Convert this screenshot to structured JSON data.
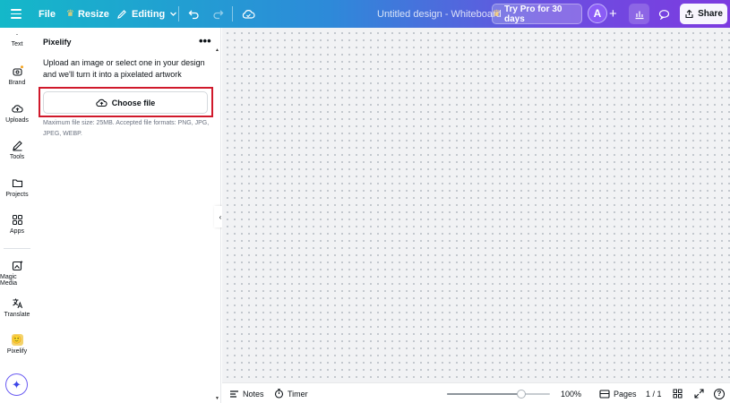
{
  "topbar": {
    "file_label": "File",
    "resize_label": "Resize",
    "editing_label": "Editing",
    "design_title": "Untitled design - Whiteboard",
    "pro_label": "Try Pro for 30 days",
    "avatar_initial": "A",
    "share_label": "Share",
    "gradient_colors": [
      "#14b8c9",
      "#2d8ad9",
      "#6b4fe0",
      "#7d3ae0"
    ]
  },
  "rail": {
    "items": [
      {
        "label": "Text",
        "icon": "text-icon"
      },
      {
        "label": "Brand",
        "icon": "brand-icon"
      },
      {
        "label": "Uploads",
        "icon": "cloud-upload-icon"
      },
      {
        "label": "Tools",
        "icon": "pen-icon"
      },
      {
        "label": "Projects",
        "icon": "folder-icon"
      },
      {
        "label": "Apps",
        "icon": "apps-grid-icon"
      },
      {
        "label": "Magic Media",
        "icon": "magic-media-icon"
      },
      {
        "label": "Translate",
        "icon": "translate-icon"
      },
      {
        "label": "Pixelify",
        "icon": "pixelify-thumb-icon"
      }
    ]
  },
  "panel": {
    "title": "Pixelify",
    "description": "Upload an image or select one in your design and we'll turn it into a pixelated artwork",
    "choose_file_label": "Choose file",
    "note": "Maximum file size: 25MB. Accepted file formats: PNG, JPG, JPEG, WEBP.",
    "highlight_color": "#d0192b"
  },
  "bottombar": {
    "notes_label": "Notes",
    "timer_label": "Timer",
    "zoom_fraction": 0.72,
    "zoom_label": "100%",
    "pages_label": "Pages",
    "page_count": "1 / 1"
  }
}
